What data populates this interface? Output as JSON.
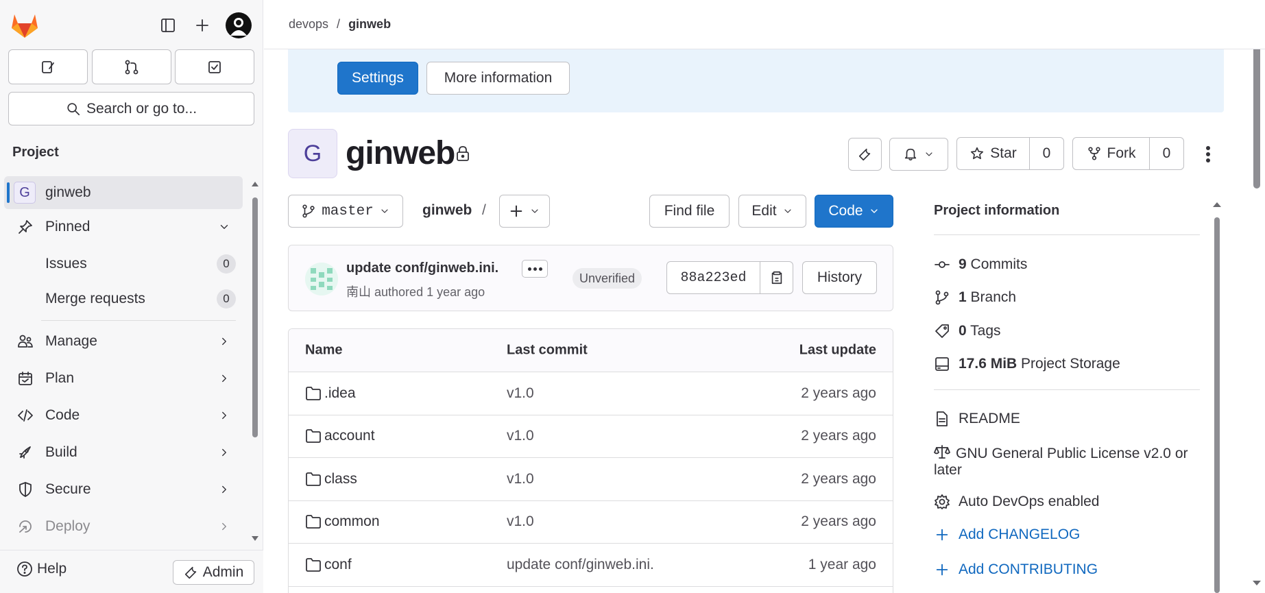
{
  "sidebar": {
    "search_label": "Search or go to...",
    "section_title": "Project",
    "project_item": {
      "initial": "G",
      "label": "ginweb"
    },
    "pinned": {
      "label": "Pinned"
    },
    "pinned_items": [
      {
        "label": "Issues",
        "count": "0"
      },
      {
        "label": "Merge requests",
        "count": "0"
      }
    ],
    "items": [
      {
        "label": "Manage",
        "icon": "users-icon"
      },
      {
        "label": "Plan",
        "icon": "calendar-icon"
      },
      {
        "label": "Code",
        "icon": "code-icon"
      },
      {
        "label": "Build",
        "icon": "rocket-icon"
      },
      {
        "label": "Secure",
        "icon": "shield-icon"
      },
      {
        "label": "Deploy",
        "icon": "deploy-icon"
      }
    ],
    "help_label": "Help",
    "admin_label": "Admin"
  },
  "breadcrumb": {
    "group": "devops",
    "separator": "/",
    "project": "ginweb"
  },
  "alert": {
    "settings_label": "Settings",
    "more_info_label": "More information"
  },
  "project": {
    "initial": "G",
    "name": "ginweb",
    "star_label": "Star",
    "star_count": "0",
    "fork_label": "Fork",
    "fork_count": "0"
  },
  "repo_bar": {
    "branch": "master",
    "path_root": "ginweb",
    "path_sep": "/",
    "find_file_label": "Find file",
    "edit_label": "Edit",
    "code_label": "Code"
  },
  "last_commit": {
    "message": "update conf/ginweb.ini.",
    "author": "南山",
    "meta_suffix": "authored 1 year ago",
    "status": "Unverified",
    "sha": "88a223ed",
    "history_label": "History"
  },
  "file_table": {
    "headers": [
      "Name",
      "Last commit",
      "Last update"
    ],
    "rows": [
      {
        "name": ".idea",
        "commit": "v1.0",
        "updated": "2 years ago"
      },
      {
        "name": "account",
        "commit": "v1.0",
        "updated": "2 years ago"
      },
      {
        "name": "class",
        "commit": "v1.0",
        "updated": "2 years ago"
      },
      {
        "name": "common",
        "commit": "v1.0",
        "updated": "2 years ago"
      },
      {
        "name": "conf",
        "commit": "update conf/ginweb.ini.",
        "updated": "1 year ago"
      }
    ]
  },
  "project_info": {
    "title": "Project information",
    "commits": {
      "count": "9",
      "label": "Commits"
    },
    "branches": {
      "count": "1",
      "label": "Branch"
    },
    "tags": {
      "count": "0",
      "label": "Tags"
    },
    "storage": {
      "size": "17.6 MiB",
      "label": "Project Storage"
    },
    "readme": "README",
    "license": "GNU General Public License v2.0 or later",
    "auto_devops": "Auto DevOps enabled",
    "add_changelog": "Add CHANGELOG",
    "add_contributing": "Add CONTRIBUTING"
  },
  "colors": {
    "primary": "#1f75cb",
    "link": "#1068bf",
    "alert_bg": "#e9f3fc",
    "sidebar_bg": "#f7f7f8"
  }
}
